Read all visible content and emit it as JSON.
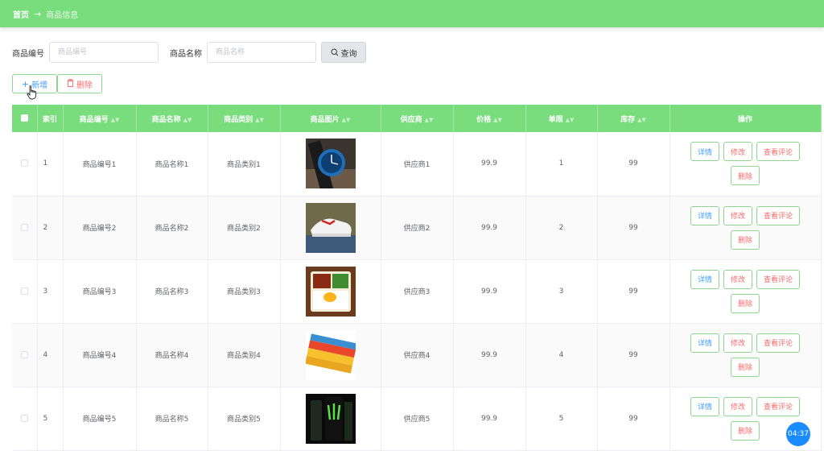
{
  "breadcrumb": {
    "home": "首页",
    "separator": "→",
    "current": "商品信息"
  },
  "search": {
    "code_label": "商品编号",
    "code_placeholder": "商品编号",
    "name_label": "商品名称",
    "name_placeholder": "商品名称",
    "query_label": "查询"
  },
  "actions": {
    "add_label": "新增",
    "delete_label": "删除"
  },
  "table": {
    "headers": [
      "索引",
      "商品编号",
      "商品名称",
      "商品类别",
      "商品图片",
      "供应商",
      "价格",
      "单限",
      "库存",
      "操作"
    ],
    "ops": {
      "detail": "详情",
      "edit": "修改",
      "review": "查看评论",
      "remove": "删除"
    },
    "rows": [
      {
        "index": "1",
        "code": "商品编号1",
        "name": "商品名称1",
        "category": "商品类别1",
        "image": "watch",
        "supplier": "供应商1",
        "price": "99.9",
        "limit": "1",
        "stock": "99"
      },
      {
        "index": "2",
        "code": "商品编号2",
        "name": "商品名称2",
        "category": "商品类别2",
        "image": "sneaker",
        "supplier": "供应商2",
        "price": "99.9",
        "limit": "2",
        "stock": "99"
      },
      {
        "index": "3",
        "code": "商品编号3",
        "name": "商品名称3",
        "category": "商品类别3",
        "image": "bento",
        "supplier": "供应商3",
        "price": "99.9",
        "limit": "3",
        "stock": "99"
      },
      {
        "index": "4",
        "code": "商品编号4",
        "name": "商品名称4",
        "category": "商品类别4",
        "image": "snack",
        "supplier": "供应商4",
        "price": "99.9",
        "limit": "4",
        "stock": "99"
      },
      {
        "index": "5",
        "code": "商品编号5",
        "name": "商品名称5",
        "category": "商品类别5",
        "image": "energy-drink",
        "supplier": "供应商5",
        "price": "99.9",
        "limit": "5",
        "stock": "99"
      }
    ]
  },
  "timer": "04:37",
  "colors": {
    "header_green": "#79dd7e",
    "primary_blue": "#409eff",
    "danger_red": "#f56c6c"
  }
}
